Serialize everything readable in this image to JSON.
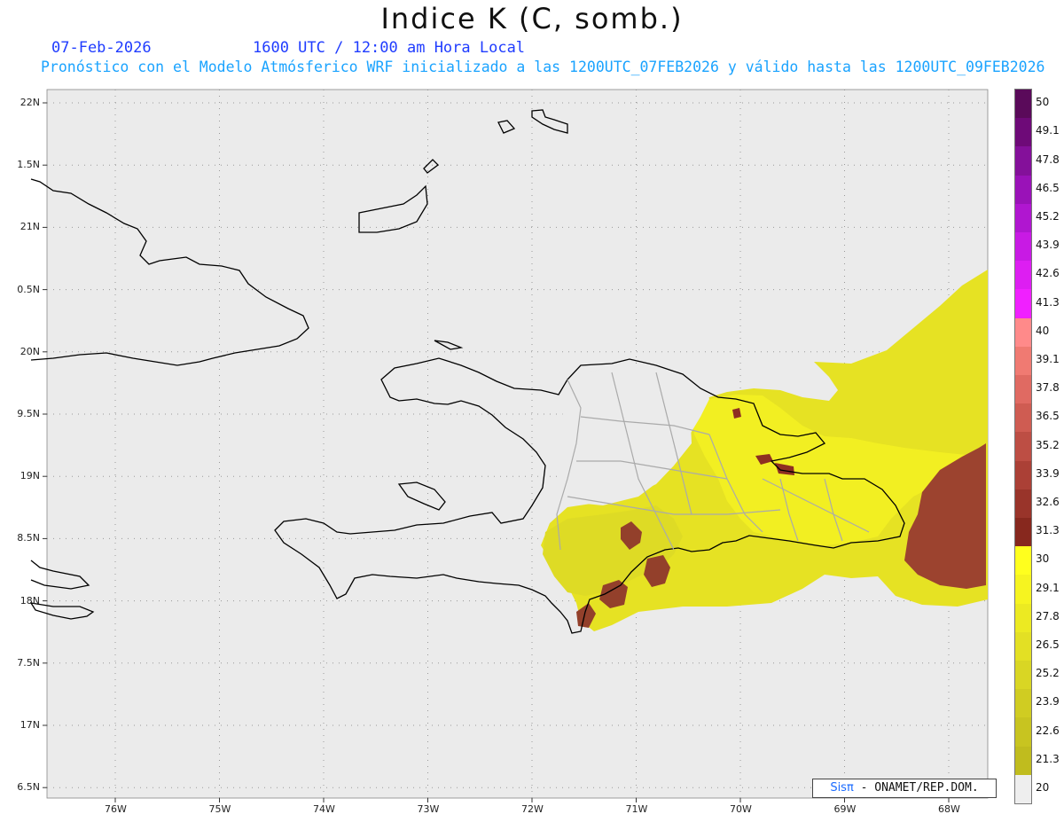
{
  "header": {
    "title": "Indice K (C, somb.)",
    "date": "07-Feb-2026",
    "time": "1600 UTC / 12:00 am Hora Local",
    "subtitle": "Pronóstico con el Modelo Atmósferico WRF inicializado a las 1200UTC_07FEB2026 y válido hasta las  1200UTC_09FEB2026"
  },
  "map": {
    "background_color": "#ebebeb",
    "lat_labels": [
      "22N",
      "1.5N",
      "21N",
      "0.5N",
      "20N",
      "9.5N",
      "19N",
      "8.5N",
      "18N",
      "7.5N",
      "17N",
      "6.5N"
    ],
    "lon_labels": [
      "76W",
      "75W",
      "74W",
      "73W",
      "72W",
      "71W",
      "70W",
      "69W",
      "68W"
    ]
  },
  "legend": {
    "entries": [
      {
        "label": "50",
        "color": "#5a0a5a"
      },
      {
        "label": "49.1",
        "color": "#6e0a78"
      },
      {
        "label": "47.8",
        "color": "#84109a"
      },
      {
        "label": "46.5",
        "color": "#9a12b8"
      },
      {
        "label": "45.2",
        "color": "#b016d0"
      },
      {
        "label": "43.9",
        "color": "#c81ae4"
      },
      {
        "label": "42.6",
        "color": "#dd1ef2"
      },
      {
        "label": "41.3",
        "color": "#f020ff"
      },
      {
        "label": "40",
        "color": "#ff8a8a"
      },
      {
        "label": "39.1",
        "color": "#f07a72"
      },
      {
        "label": "37.8",
        "color": "#e06a62"
      },
      {
        "label": "36.5",
        "color": "#cf5c52"
      },
      {
        "label": "35.2",
        "color": "#bd4e44"
      },
      {
        "label": "33.9",
        "color": "#ab4036"
      },
      {
        "label": "32.6",
        "color": "#99342a"
      },
      {
        "label": "31.3",
        "color": "#87281e"
      },
      {
        "label": "30",
        "color": "#ffff1e"
      },
      {
        "label": "29.1",
        "color": "#f6f420"
      },
      {
        "label": "27.8",
        "color": "#ecea22"
      },
      {
        "label": "26.5",
        "color": "#e3e024"
      },
      {
        "label": "25.2",
        "color": "#d9d624"
      },
      {
        "label": "23.9",
        "color": "#d0cc22"
      },
      {
        "label": "22.6",
        "color": "#c8c420"
      },
      {
        "label": "21.3",
        "color": "#c0bc1e"
      },
      {
        "label": "20",
        "color": "#eeeeee"
      }
    ]
  },
  "credit": {
    "sis": "Sisπ",
    "org": " - ONAMET/REP.DOM."
  }
}
